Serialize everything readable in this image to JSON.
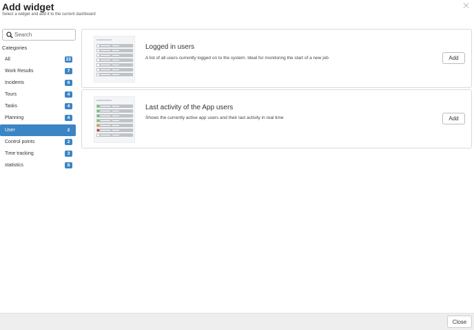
{
  "dialog": {
    "title": "Add widget",
    "subtitle": "Select a widget and add it to the current dashboard"
  },
  "search": {
    "placeholder": "Search",
    "value": ""
  },
  "categories": {
    "heading": "Categories",
    "items": [
      {
        "label": "All",
        "count": "22",
        "active": false
      },
      {
        "label": "Work Results",
        "count": "7",
        "active": false
      },
      {
        "label": "Incidents",
        "count": "6",
        "active": false
      },
      {
        "label": "Tours",
        "count": "4",
        "active": false
      },
      {
        "label": "Tasks",
        "count": "4",
        "active": false
      },
      {
        "label": "Planning",
        "count": "4",
        "active": false
      },
      {
        "label": "User",
        "count": "2",
        "active": true
      },
      {
        "label": "Control points",
        "count": "2",
        "active": false
      },
      {
        "label": "Time tracking",
        "count": "3",
        "active": false
      },
      {
        "label": "statistics",
        "count": "8",
        "active": false
      }
    ]
  },
  "widgets": [
    {
      "title": "Logged in users",
      "description": "A list of all users currently logged on to the system. Ideal for monitoring the start of a new job",
      "add_label": "Add"
    },
    {
      "title": "Last activity of the App users",
      "description": "Shows the currently active app users and their last activity in real time",
      "add_label": "Add"
    }
  ],
  "footer": {
    "close_label": "Close"
  },
  "colors": {
    "accent": "#3b85c4",
    "footer_bg": "#eeeeee"
  }
}
